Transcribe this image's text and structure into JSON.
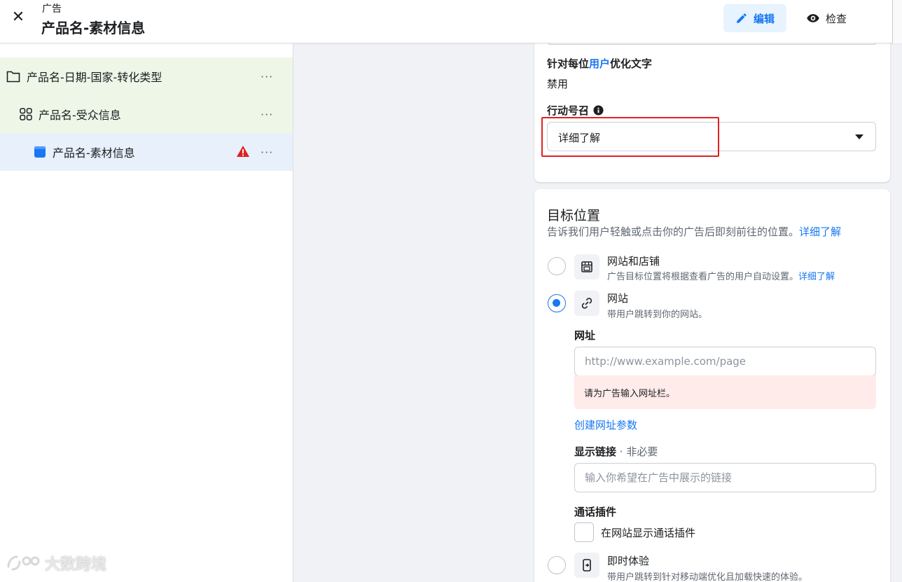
{
  "header": {
    "close_icon": "close-icon",
    "subtitle": "广告",
    "title": "产品名-素材信息",
    "edit_label": "编辑",
    "review_label": "检查",
    "accent": "#1877f2"
  },
  "tree": {
    "campaign": {
      "label": "产品名-日期-国家-转化类型",
      "icon": "folder-icon",
      "more": "···"
    },
    "adset": {
      "label": "产品名-受众信息",
      "icon": "grid-icon",
      "more": "···"
    },
    "ad": {
      "label": "产品名-素材信息",
      "icon": "ad-icon",
      "warning_icon": "warning-icon",
      "more": "···"
    }
  },
  "creative": {
    "optimize_label_prefix": "针对每位",
    "optimize_label_link": "用户",
    "optimize_label_suffix": "优化文字",
    "optimize_value": "禁用",
    "cta_label": "行动号召",
    "cta_info_icon": "info-icon",
    "cta_value": "详细了解"
  },
  "destination": {
    "title": "目标位置",
    "description": "告诉我们用户轻触或点击你的广告后即刻前往的位置。",
    "learn_more": "详细了解",
    "options": [
      {
        "title": "网站和店铺",
        "desc": "广告目标位置将根据查看广告的用户自动设置。",
        "desc_link": "详细了解",
        "selected": false,
        "icon": "storefront-icon"
      },
      {
        "title": "网站",
        "desc": "带用户跳转到你的网站。",
        "selected": true,
        "icon": "link-icon"
      },
      {
        "title": "即时体验",
        "desc": "带用户跳转到针对移动端优化且加载快速的体验。",
        "selected": false,
        "icon": "instant-experience-icon"
      }
    ],
    "url_label": "网址",
    "url_placeholder": "http://www.example.com/page",
    "url_error": "请为广告输入网址栏。",
    "build_params_link": "创建网址参数",
    "display_link_label": "显示链接",
    "display_link_optional": " · 非必要",
    "display_link_placeholder": "输入你希望在广告中展示的链接",
    "call_ext_label": "通话插件",
    "call_ext_checkbox": "在网站显示通话插件"
  },
  "watermark": {
    "text": "大数跨境",
    "icon": "watermark-logo-icon"
  }
}
